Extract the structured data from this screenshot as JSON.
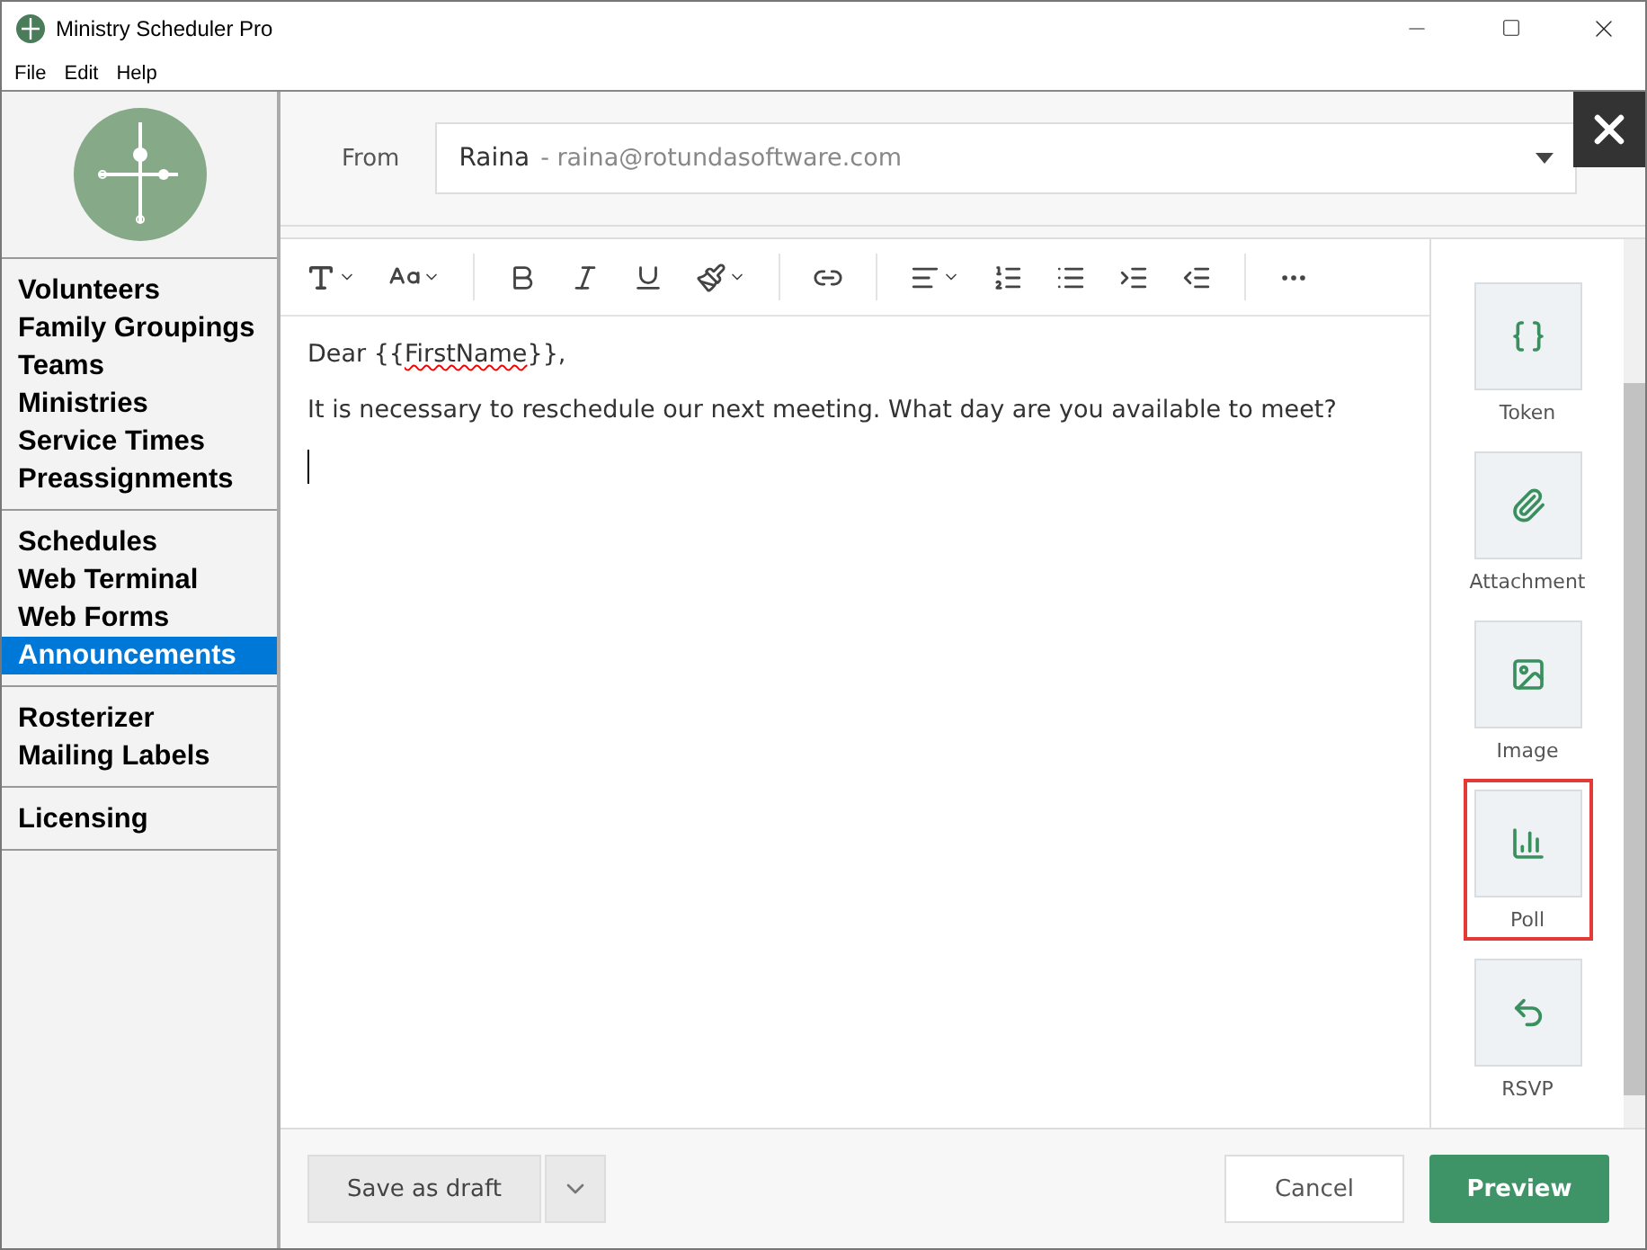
{
  "window": {
    "title": "Ministry Scheduler Pro"
  },
  "menu": [
    "File",
    "Edit",
    "Help"
  ],
  "sidebar": {
    "groups": [
      {
        "items": [
          {
            "label": "Volunteers",
            "selected": false
          },
          {
            "label": "Family Groupings",
            "selected": false
          },
          {
            "label": "Teams",
            "selected": false
          },
          {
            "label": "Ministries",
            "selected": false
          },
          {
            "label": "Service Times",
            "selected": false
          },
          {
            "label": "Preassignments",
            "selected": false
          }
        ]
      },
      {
        "items": [
          {
            "label": "Schedules",
            "selected": false
          },
          {
            "label": "Web Terminal",
            "selected": false
          },
          {
            "label": "Web Forms",
            "selected": false
          },
          {
            "label": "Announcements",
            "selected": true
          }
        ]
      },
      {
        "items": [
          {
            "label": "Rosterizer",
            "selected": false
          },
          {
            "label": "Mailing Labels",
            "selected": false
          }
        ]
      },
      {
        "items": [
          {
            "label": "Licensing",
            "selected": false
          }
        ]
      }
    ]
  },
  "from": {
    "label": "From",
    "name": "Raina",
    "email": "- raina@rotundasoftware.com"
  },
  "editor": {
    "paragraphs": [
      {
        "kind": "greeting",
        "before": "Dear {{",
        "token": "FirstName",
        "after": "}},"
      },
      {
        "kind": "text",
        "text": "It is necessary to reschedule our next meeting. What day are you available to meet?"
      },
      {
        "kind": "cursor"
      }
    ]
  },
  "insert_panel": [
    {
      "kind": "token",
      "label": "Token",
      "highlighted": false
    },
    {
      "kind": "attachment",
      "label": "Attachment",
      "highlighted": false
    },
    {
      "kind": "image",
      "label": "Image",
      "highlighted": false
    },
    {
      "kind": "poll",
      "label": "Poll",
      "highlighted": true
    },
    {
      "kind": "rsvp",
      "label": "RSVP",
      "highlighted": false
    }
  ],
  "footer": {
    "draft": "Save as draft",
    "cancel": "Cancel",
    "preview": "Preview"
  }
}
